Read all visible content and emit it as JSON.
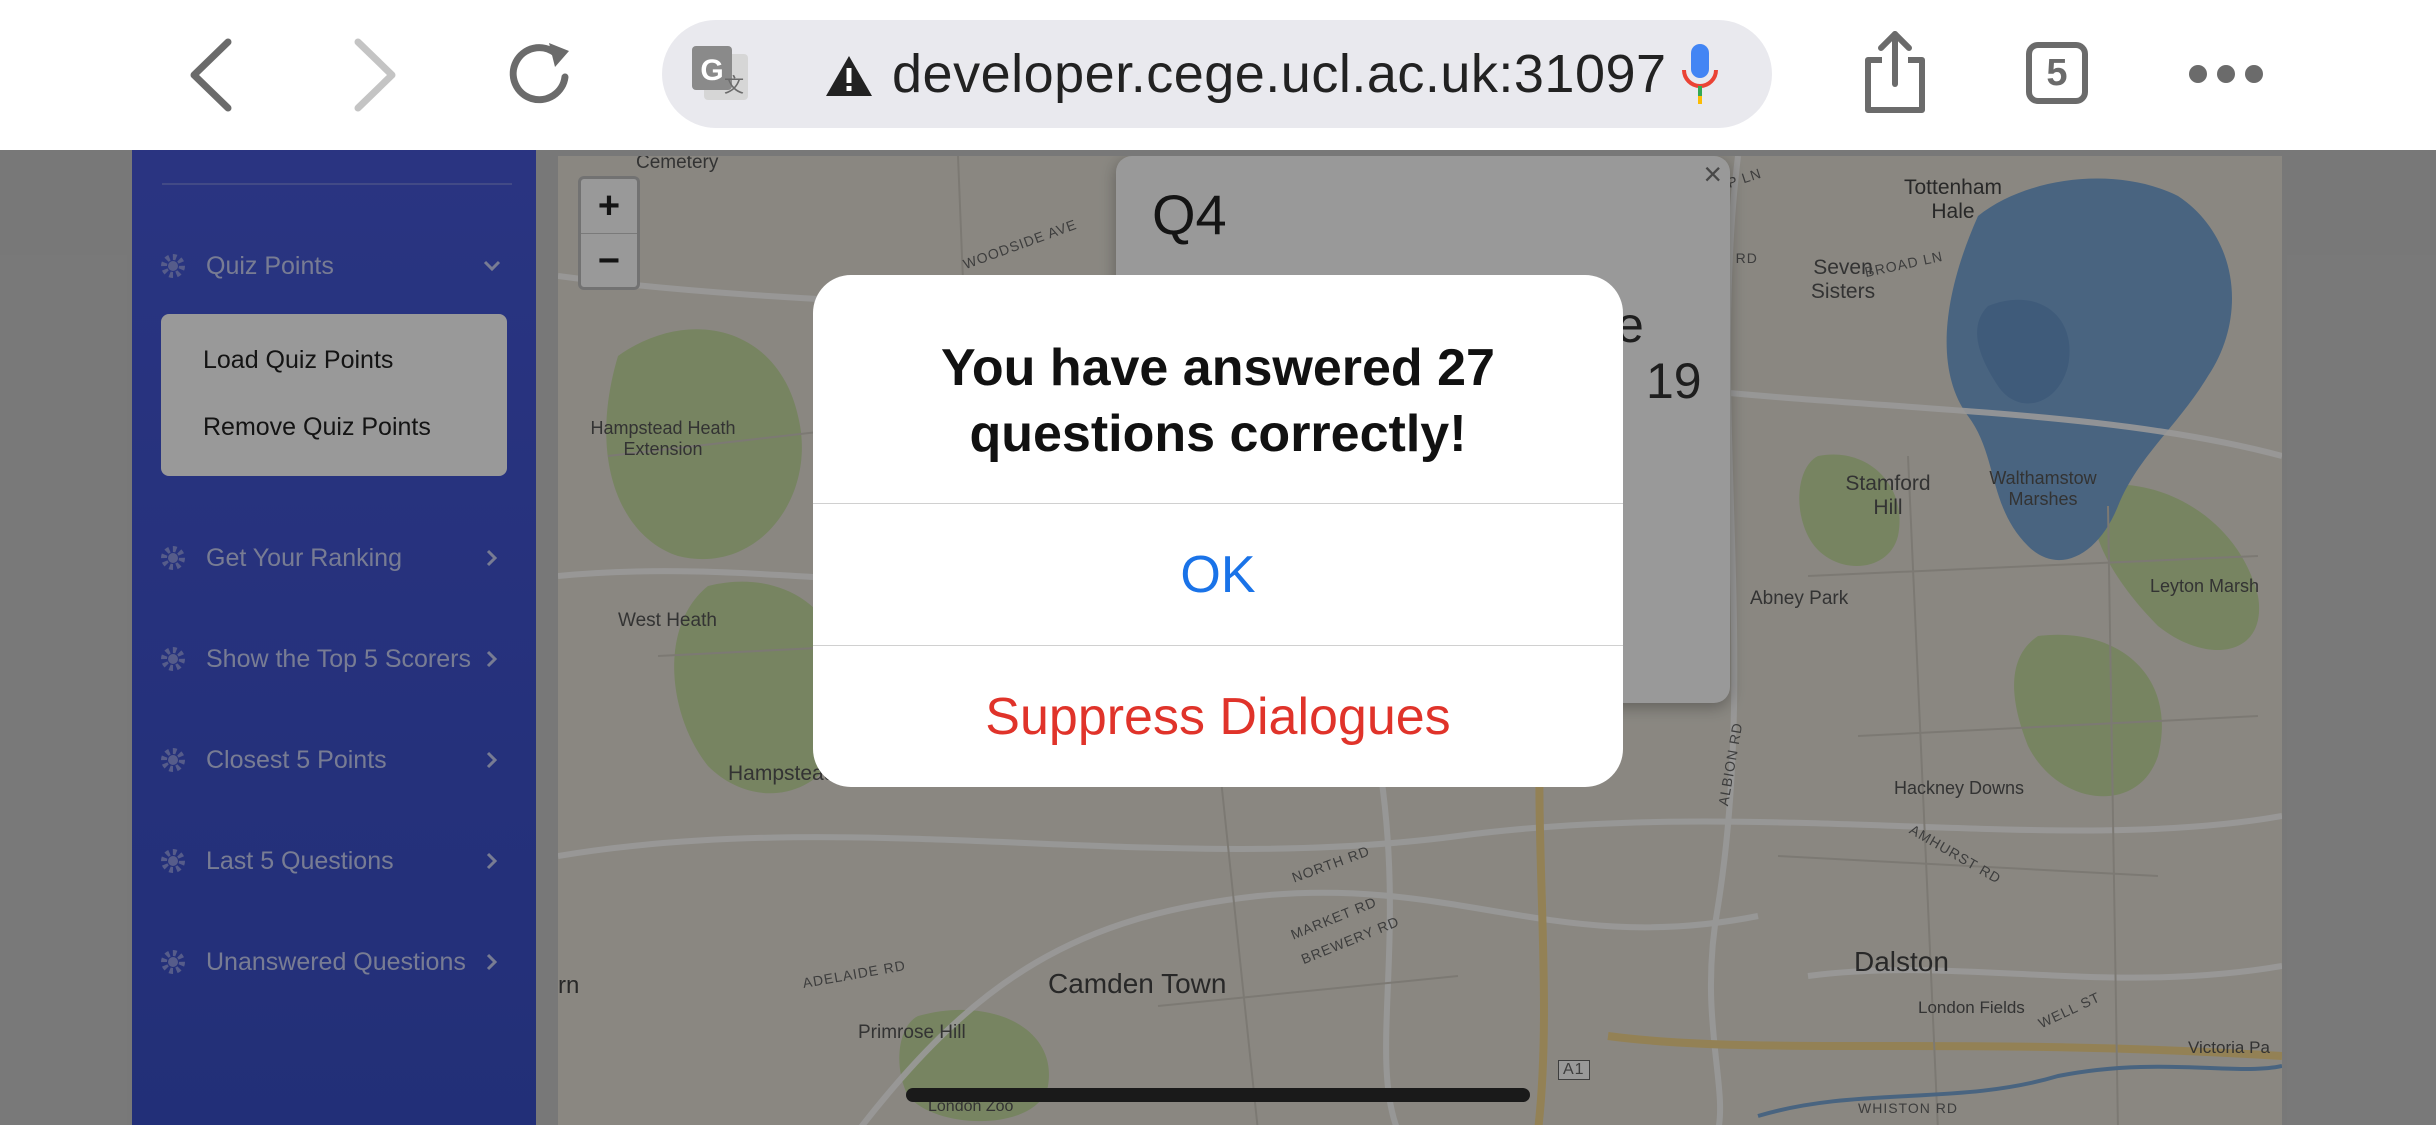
{
  "browser": {
    "url": "developer.cege.ucl.ac.uk:31097",
    "tab_count": "5",
    "icons": [
      "back-icon",
      "forward-icon",
      "reload-icon",
      "translate-icon",
      "warning-icon",
      "microphone-icon",
      "share-icon",
      "tabs-icon",
      "more-icon"
    ]
  },
  "sidebar": {
    "items": [
      {
        "label": "Quiz Points"
      },
      {
        "label": "Get Your Ranking"
      },
      {
        "label": "Show the Top 5 Scorers"
      },
      {
        "label": "Closest 5 Points"
      },
      {
        "label": "Last 5 Questions"
      },
      {
        "label": "Unanswered Questions"
      }
    ],
    "submenu": [
      "Load Quiz Points",
      "Remove Quiz Points"
    ]
  },
  "map": {
    "zoom_in": "+",
    "zoom_out": "−",
    "labels": [
      "Cemetery",
      "Tottenham Hale",
      "Seven Sisters",
      "Hampstead Heath Extension",
      "Stamford Hill",
      "Walthamstow Marshes",
      "Leyton Marsh",
      "West Heath",
      "Abney Park",
      "Hampstead",
      "Hackney Downs",
      "Camden Town",
      "Dalston",
      "Primrose Hill",
      "London Fields",
      "Victoria Pa",
      "London Zoo",
      "rn"
    ],
    "roads": [
      "WOODSIDE AVE",
      "PHILIP LN",
      "GREEN RD",
      "BROAD LN",
      "NORTH RD",
      "MARKET RD",
      "BREWERY RD",
      "ADELAIDE RD",
      "ALBION RD",
      "AMHURST RD",
      "WELL ST",
      "WHISTON RD",
      "A1"
    ]
  },
  "popup": {
    "title": "Q4",
    "close": "×",
    "partial_text_1": "e",
    "partial_text_2": "19"
  },
  "dialog": {
    "message_line1": "You have answered 27",
    "message_line2": "questions correctly!",
    "ok_label": "OK",
    "suppress_label": "Suppress Dialogues"
  },
  "colors": {
    "sidebar": "#4658d8",
    "ok": "#1a73e8",
    "suppress": "#e0332a"
  }
}
